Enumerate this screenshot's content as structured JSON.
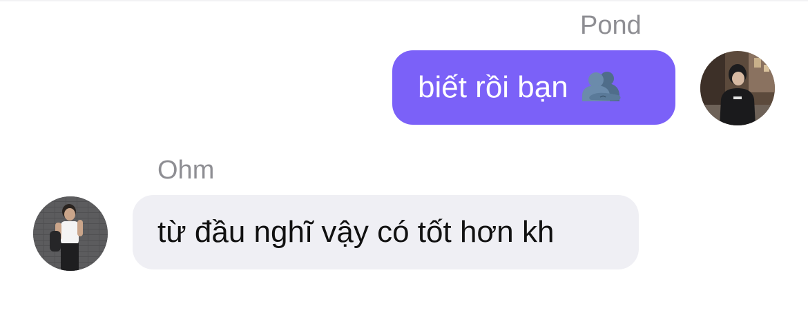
{
  "messages": [
    {
      "sender": "Pond",
      "text": "biết rồi bạn",
      "emoji": "people-hugging-emoji",
      "direction": "outgoing",
      "bubble_color": "#7b61f8",
      "text_color": "#ffffff"
    },
    {
      "sender": "Ohm",
      "text": "từ đầu nghĩ vậy có tốt hơn kh",
      "direction": "incoming",
      "bubble_color": "#efeff4",
      "text_color": "#111111"
    }
  ],
  "colors": {
    "sender_name": "#8e8e93",
    "background": "#ffffff"
  }
}
